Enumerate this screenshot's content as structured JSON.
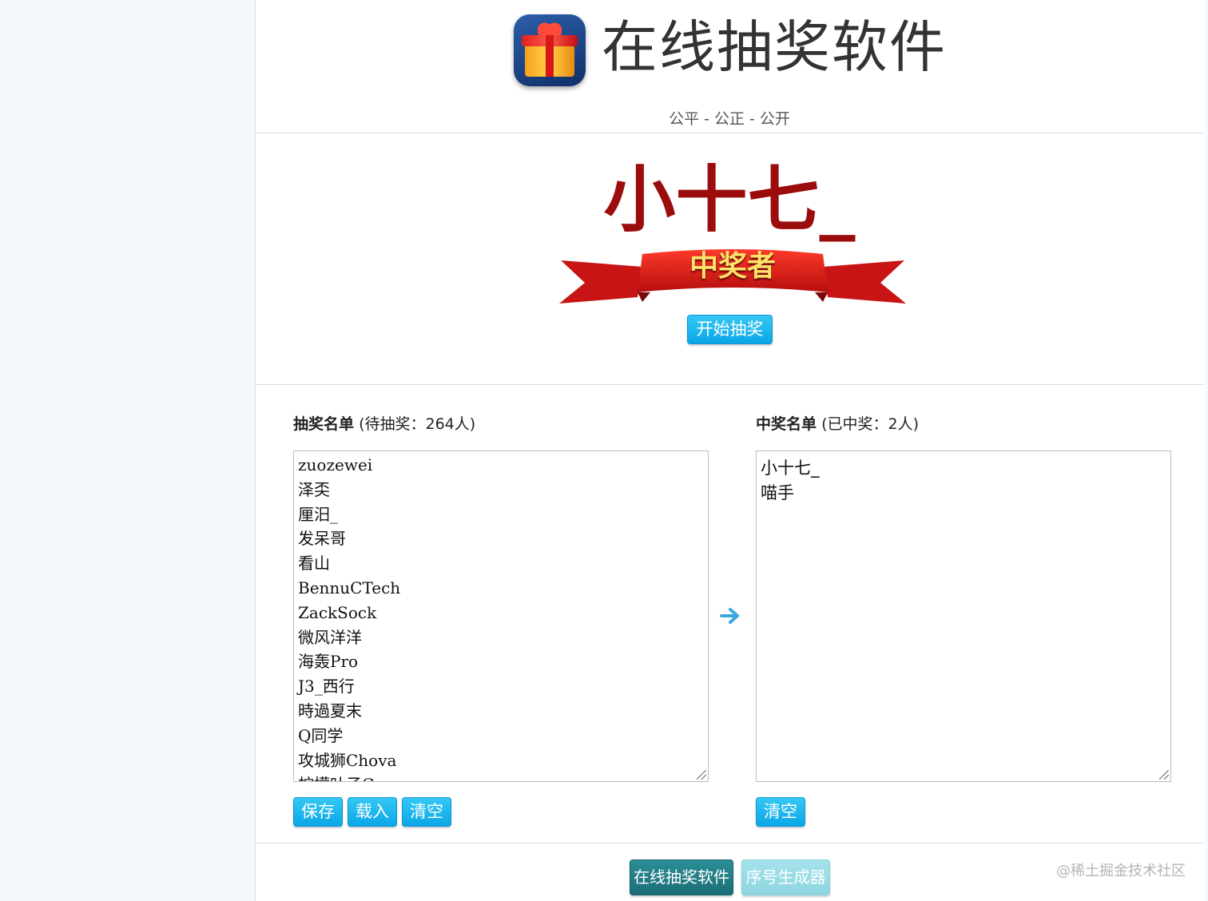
{
  "header": {
    "title": "在线抽奖软件",
    "subtitle": "公平 - 公正 - 公开",
    "icon": "gift-box-icon"
  },
  "winner": {
    "name": "小十七_",
    "banner_text": "中奖者",
    "start_label": "开始抽奖"
  },
  "draw_list": {
    "title": "抽奖名单",
    "count_text": "(待抽奖：264人)",
    "entries": [
      "zuozewei",
      "泽奀",
      "厘汨_",
      "发呆哥",
      "看山",
      "BennuCTech",
      "ZackSock",
      "微风洋洋",
      "海轰Pro",
      "J3_西行",
      "時過夏末",
      "Q同学",
      "攻城狮Chova",
      "柠檬叶子C"
    ],
    "buttons": {
      "save": "保存",
      "load": "载入",
      "clear": "清空"
    }
  },
  "winner_list": {
    "title": "中奖名单",
    "count_text": "(已中奖：2人)",
    "entries": [
      "小十七_",
      "喵手"
    ],
    "buttons": {
      "clear": "清空"
    }
  },
  "footer": {
    "tabs": [
      "在线抽奖软件",
      "序号生成器"
    ],
    "watermark": "@稀土掘金技术社区"
  },
  "colors": {
    "accent": "#0aa6e6",
    "winner_text": "#9b0d0d",
    "banner_red": "#d81818",
    "footer_active": "#1b6e77",
    "footer_inactive": "#8ed6e0"
  }
}
